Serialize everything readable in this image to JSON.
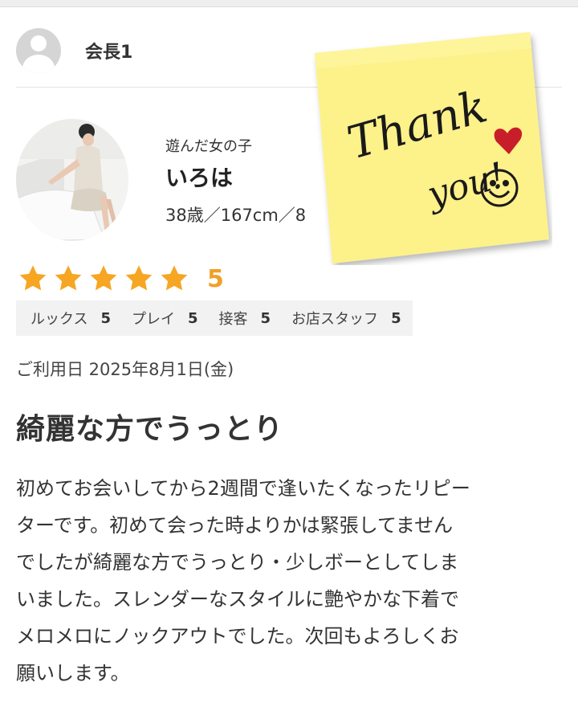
{
  "reviewer": {
    "name": "会長1",
    "avatar_icon": "user-silhouette-icon"
  },
  "girl": {
    "label": "遊んだ女の子",
    "name": "いろは",
    "stats": "38歳／167cm／8"
  },
  "sticky_note": {
    "line1": "Thank",
    "line2": "you!",
    "color": "#fdf18a"
  },
  "rating": {
    "stars": 5,
    "score": "5",
    "star_color": "#f6a623",
    "sub": [
      {
        "label": "ルックス",
        "value": "5"
      },
      {
        "label": "プレイ",
        "value": "5"
      },
      {
        "label": "接客",
        "value": "5"
      },
      {
        "label": "お店スタッフ",
        "value": "5"
      }
    ]
  },
  "visit": {
    "text": "ご利用日 2025年8月1日(金)"
  },
  "review": {
    "title": "綺麗な方でうっとり",
    "body_lines": [
      "初めてお会いしてから2週間で逢いたくなったリピー",
      "ターです。初めて会った時よりかは緊張してません",
      "でしたが綺麗な方でうっとり・少しボーとしてしま",
      "いました。スレンダーなスタイルに艶やかな下着で",
      "メロメロにノックアウトでした。次回もよろしくお",
      "願いします。"
    ]
  }
}
